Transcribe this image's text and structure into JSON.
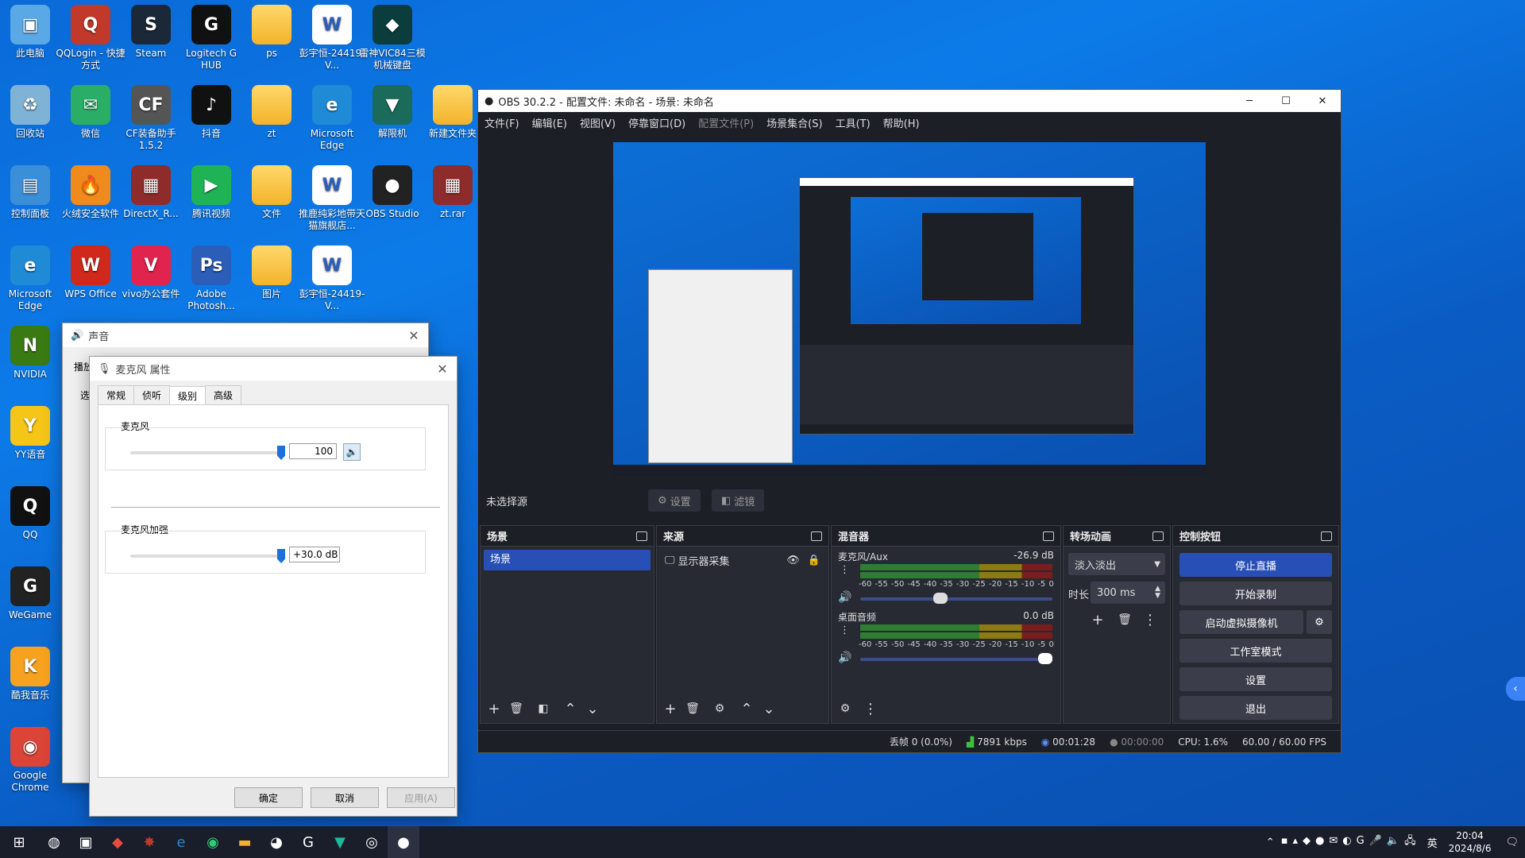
{
  "desktop": {
    "icons": [
      {
        "label": "此电脑",
        "glyph": "▣",
        "color": "#5aa9e6"
      },
      {
        "label": "QQLogin - 快捷方式",
        "glyph": "Q",
        "color": "#c0392b"
      },
      {
        "label": "Steam",
        "glyph": "S",
        "color": "#1b2838"
      },
      {
        "label": "Logitech G HUB",
        "glyph": "G",
        "color": "#111"
      },
      {
        "label": "ps",
        "glyph": "",
        "color": "folder"
      },
      {
        "label": "彭宇恒-24419-V...",
        "glyph": "W",
        "color": "doc"
      },
      {
        "label": "雷神VIC84三模机械键盘",
        "glyph": "◆",
        "color": "#0b3d3d"
      },
      {
        "label": "回收站",
        "glyph": "♻",
        "color": "#7fb3d5"
      },
      {
        "label": "微信",
        "glyph": "✉",
        "color": "#2aae67"
      },
      {
        "label": "CF装备助手1.5.2",
        "glyph": "CF",
        "color": "#555"
      },
      {
        "label": "抖音",
        "glyph": "♪",
        "color": "#111"
      },
      {
        "label": "zt",
        "glyph": "",
        "color": "folder"
      },
      {
        "label": "Microsoft Edge",
        "glyph": "e",
        "color": "#1f8ad6"
      },
      {
        "label": "解限机",
        "glyph": "▼",
        "color": "#1a6b5a"
      },
      {
        "label": "新建文件夹",
        "glyph": "",
        "color": "folder"
      },
      {
        "label": "控制面板",
        "glyph": "▤",
        "color": "#3b8ed8"
      },
      {
        "label": "火绒安全软件",
        "glyph": "🔥",
        "color": "#f08a1c"
      },
      {
        "label": "DirectX_R...",
        "glyph": "▦",
        "color": "#8e2b2b"
      },
      {
        "label": "腾讯视频",
        "glyph": "▶",
        "color": "#1fb356"
      },
      {
        "label": "文件",
        "glyph": "",
        "color": "folder"
      },
      {
        "label": "推鹿纯彩地带天猫旗舰店...",
        "glyph": "W",
        "color": "doc"
      },
      {
        "label": "OBS Studio",
        "glyph": "●",
        "color": "#222"
      },
      {
        "label": "zt.rar",
        "glyph": "▦",
        "color": "#8e2b2b"
      },
      {
        "label": "Microsoft Edge",
        "glyph": "e",
        "color": "#1f8ad6"
      },
      {
        "label": "WPS Office",
        "glyph": "W",
        "color": "#d0291c"
      },
      {
        "label": "vivo办公套件",
        "glyph": "V",
        "color": "#e0244e"
      },
      {
        "label": "Adobe Photosh...",
        "glyph": "Ps",
        "color": "#2b5eb8"
      },
      {
        "label": "图片",
        "glyph": "",
        "color": "folder"
      },
      {
        "label": "彭宇恒-24419-V...",
        "glyph": "W",
        "color": "doc"
      },
      {
        "label": "NVIDIA",
        "glyph": "N",
        "color": "#3a7a12"
      },
      {
        "label": "YY语音",
        "glyph": "Y",
        "color": "#f5c518"
      },
      {
        "label": "QQ",
        "glyph": "Q",
        "color": "#111"
      },
      {
        "label": "WeGame",
        "glyph": "G",
        "color": "#222"
      },
      {
        "label": "酷我音乐",
        "glyph": "K",
        "color": "#f6a21e"
      },
      {
        "label": "Google Chrome",
        "glyph": "◉",
        "color": "#db4437"
      }
    ]
  },
  "sound_window": {
    "title": "声音",
    "tab_label": "播放",
    "side_label": "选"
  },
  "mic_props": {
    "title": "麦克风 属性",
    "tabs": [
      "常规",
      "侦听",
      "级别",
      "高级"
    ],
    "mic_label": "麦克风",
    "mic_value": "100",
    "mic_level": 1.0,
    "boost_label": "麦克风加强",
    "boost_value": "+30.0 dB",
    "boost_level": 1.0,
    "ok": "确定",
    "cancel": "取消",
    "apply": "应用(A)"
  },
  "obs": {
    "title": "OBS 30.2.2 - 配置文件: 未命名 - 场景: 未命名",
    "menu": [
      "文件(F)",
      "编辑(E)",
      "视图(V)",
      "停靠窗口(D)",
      "配置文件(P)",
      "场景集合(S)",
      "工具(T)",
      "帮助(H)"
    ],
    "no_source": "未选择源",
    "settings_btn": "设置",
    "filters_btn": "滤镜",
    "scenes": {
      "title": "场景",
      "items": [
        "场景"
      ]
    },
    "sources": {
      "title": "来源",
      "items": [
        "显示器采集"
      ]
    },
    "mixer": {
      "title": "混音器",
      "channels": [
        {
          "name": "麦克风/Aux",
          "db": "-26.9 dB",
          "volume": 0.41
        },
        {
          "name": "桌面音频",
          "db": "0.0 dB",
          "volume": 1.0
        }
      ],
      "scale": [
        "-60",
        "-55",
        "-50",
        "-45",
        "-40",
        "-35",
        "-30",
        "-25",
        "-20",
        "-15",
        "-10",
        "-5",
        "0"
      ]
    },
    "transitions": {
      "title": "转场动画",
      "type": "淡入淡出",
      "duration_label": "时长",
      "duration": "300 ms"
    },
    "controls": {
      "title": "控制按钮",
      "buttons": [
        "停止直播",
        "开始录制",
        "启动虚拟摄像机",
        "工作室模式",
        "设置",
        "退出"
      ]
    },
    "status": {
      "dropped": "丢帧 0 (0.0%)",
      "bitrate": "7891 kbps",
      "live_time": "00:01:28",
      "rec_time": "00:00:00",
      "cpu": "CPU: 1.6%",
      "fps": "60.00 / 60.00 FPS"
    }
  },
  "taskbar": {
    "time": "20:04",
    "date": "2024/8/6",
    "ime": "英"
  }
}
